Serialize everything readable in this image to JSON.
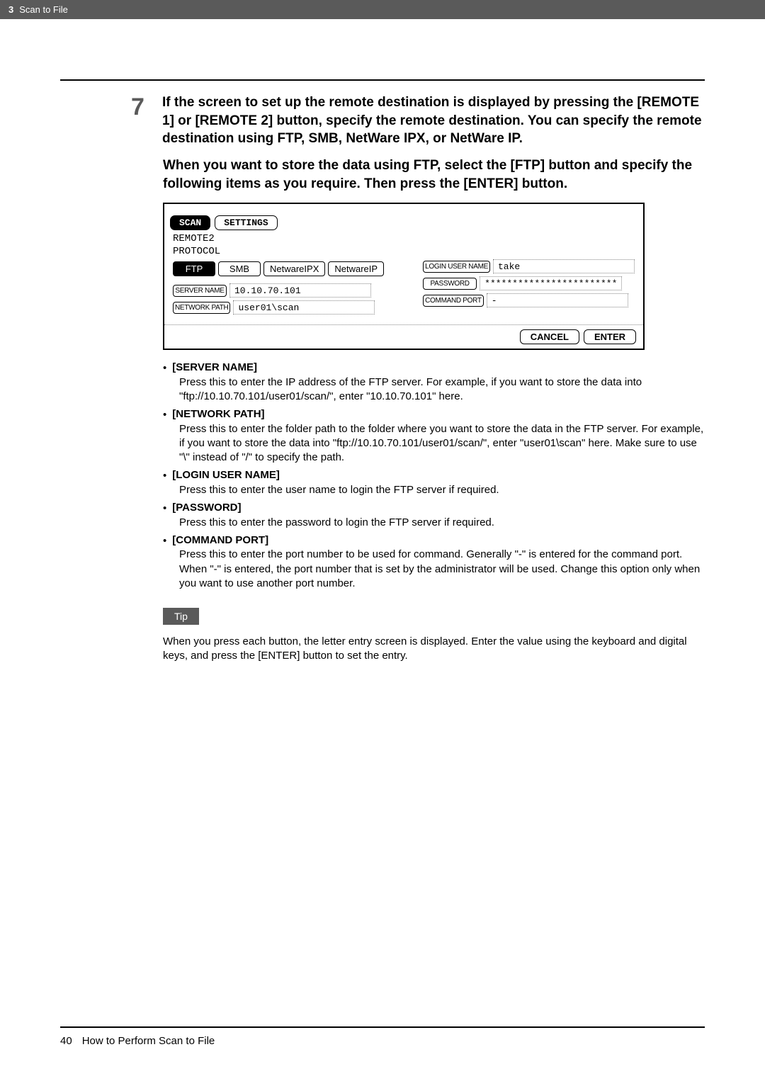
{
  "header": {
    "chapter_num": "3",
    "chapter_title": "Scan to File"
  },
  "step": {
    "number": "7",
    "heading1": "If the screen to set up the remote destination is displayed by pressing the [REMOTE 1] or [REMOTE 2] button, specify the remote destination.  You can specify the remote destination using FTP, SMB, NetWare IPX, or NetWare IP.",
    "heading2": "When you want to store the data using FTP, select the [FTP] button and specify the following items as you require. Then press the [ENTER] button."
  },
  "screenshot": {
    "tabs": {
      "scan": "SCAN",
      "settings": "SETTINGS"
    },
    "remote_label": "REMOTE2",
    "protocol_label": "PROTOCOL",
    "protocols": {
      "ftp": "FTP",
      "smb": "SMB",
      "netwareipx": "NetwareIPX",
      "netwareip": "NetwareIP"
    },
    "fields": {
      "server_name": {
        "label": "SERVER NAME",
        "value": "10.10.70.101"
      },
      "network_path": {
        "label": "NETWORK PATH",
        "value": "user01\\scan"
      },
      "login_user": {
        "label": "LOGIN USER NAME",
        "value": "take"
      },
      "password": {
        "label": "PASSWORD",
        "value": "************************"
      },
      "command_port": {
        "label": "COMMAND PORT",
        "value": "-"
      }
    },
    "actions": {
      "cancel": "CANCEL",
      "enter": "ENTER"
    }
  },
  "bullets": [
    {
      "label": "[SERVER NAME]",
      "body": "Press this to enter the IP address of the FTP server.  For example, if you want to store the data into \"ftp://10.10.70.101/user01/scan/\", enter \"10.10.70.101\" here."
    },
    {
      "label": "[NETWORK PATH]",
      "body": "Press this to enter the folder path to the folder where you want to store the data in the FTP server.  For example, if you want to store the data into \"ftp://10.10.70.101/user01/scan/\", enter \"user01\\scan\" here.  Make sure to use \"\\\" instead of \"/\" to specify the path."
    },
    {
      "label": "[LOGIN USER NAME]",
      "body": "Press this to enter the user name to login the FTP server if required."
    },
    {
      "label": "[PASSWORD]",
      "body": "Press this to enter the password to login the FTP server if required."
    },
    {
      "label": "[COMMAND PORT]",
      "body": "Press this to enter the port number to be used for command. Generally \"-\" is entered for the command port. When \"-\" is entered, the port number that is set by the administrator will be used. Change this option only when you want to use another port number."
    }
  ],
  "tip": {
    "label": "Tip",
    "text": "When you press each button, the letter entry screen is displayed. Enter the value using the keyboard and digital keys, and press the [ENTER] button to set the entry."
  },
  "footer": {
    "page_num": "40",
    "text": "How to Perform Scan to File"
  }
}
